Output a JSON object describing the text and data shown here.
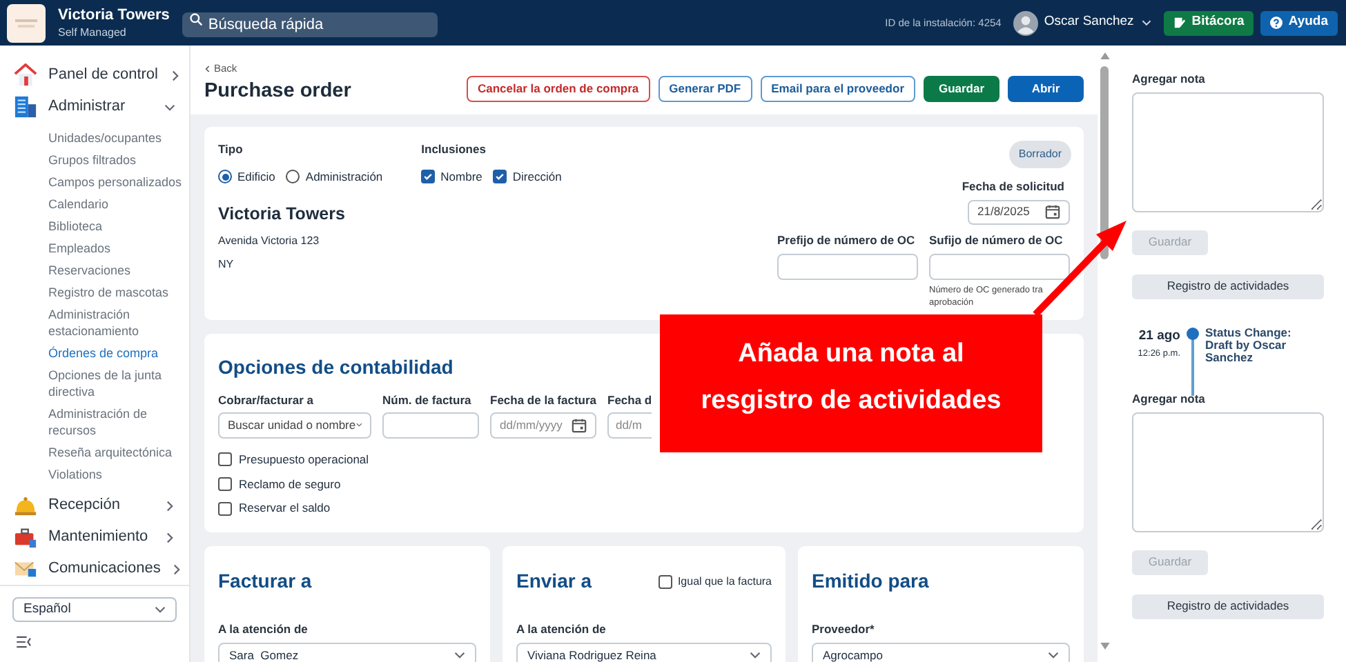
{
  "header": {
    "org_name": "Victoria Towers",
    "org_subtitle": "Self Managed",
    "search": {
      "placeholder": "Búsqueda rápida"
    },
    "installation_id": "ID de la instalación: 4254",
    "user_name": "Oscar Sanchez",
    "buttons": [
      {
        "label": "Bitácora",
        "kind": "log"
      },
      {
        "label": "Ayuda",
        "kind": "help"
      }
    ]
  },
  "sidebar": {
    "items": [
      {
        "label": "Panel de control",
        "expanded": false
      },
      {
        "label": "Administrar",
        "expanded": true,
        "children": [
          {
            "label": "Unidades/ocupantes",
            "selected": false
          },
          {
            "label": "Grupos filtrados",
            "selected": false
          },
          {
            "label": "Campos personalizados",
            "selected": false
          },
          {
            "label": "Calendario",
            "selected": false
          },
          {
            "label": "Biblioteca",
            "selected": false
          },
          {
            "label": "Empleados",
            "selected": false
          },
          {
            "label": "Reservaciones",
            "selected": false
          },
          {
            "label": "Registro de mascotas",
            "selected": false
          },
          {
            "label": "Administración estacionamiento",
            "selected": false
          },
          {
            "label": "Órdenes de compra",
            "selected": true
          },
          {
            "label": "Opciones de la junta directiva",
            "selected": false
          },
          {
            "label": "Administración de recursos",
            "selected": false
          },
          {
            "label": "Reseña arquitectónica",
            "selected": false
          },
          {
            "label": "Violations",
            "selected": false
          }
        ]
      },
      {
        "label": "Recepción",
        "expanded": false
      },
      {
        "label": "Mantenimiento",
        "expanded": false
      },
      {
        "label": "Comunicaciones",
        "expanded": false
      }
    ],
    "language": "Español"
  },
  "page": {
    "back": "Back",
    "title": "Purchase order",
    "actions": [
      {
        "label": "Cancelar la orden de compra",
        "kind": "danger"
      },
      {
        "label": "Generar PDF",
        "kind": "outline"
      },
      {
        "label": "Email para el proveedor",
        "kind": "outline"
      },
      {
        "label": "Guardar",
        "kind": "success"
      },
      {
        "label": "Abrir",
        "kind": "primary"
      }
    ]
  },
  "header_card": {
    "tipo_label": "Tipo",
    "tipo_options": [
      {
        "label": "Edificio",
        "selected": true
      },
      {
        "label": "Administración",
        "selected": false
      }
    ],
    "inclusions_label": "Inclusiones",
    "inclusions": [
      {
        "label": "Nombre",
        "checked": true
      },
      {
        "label": "Dirección",
        "checked": true
      }
    ],
    "status": "Borrador",
    "building_name": "Victoria Towers",
    "address_lines": [
      "Avenida Victoria 123",
      "NY"
    ],
    "request_date_label": "Fecha de solicitud",
    "request_date": "21/8/2025",
    "prefix_label": "Prefijo de número de OC",
    "suffix_label": "Sufijo de número de OC",
    "suffix_hint_lines": [
      "Número de OC generado tra",
      "aprobación"
    ]
  },
  "accounting": {
    "title": "Opciones de contabilidad",
    "fields": [
      {
        "label": "Cobrar/facturar a",
        "kind": "select",
        "placeholder": "Buscar unidad o nombre"
      },
      {
        "label": "Núm. de factura",
        "kind": "text"
      },
      {
        "label": "Fecha de la factura",
        "kind": "date",
        "placeholder": "dd/mm/yyyy"
      },
      {
        "label": "Fecha d",
        "kind": "cut",
        "placeholder": "dd/m"
      }
    ],
    "checkboxes": [
      {
        "label": "Presupuesto operacional",
        "checked": false
      },
      {
        "label": "Reclamo de seguro",
        "checked": false
      },
      {
        "label": "Reservar el saldo",
        "checked": false
      }
    ]
  },
  "parties": [
    {
      "title": "Facturar a",
      "field_label": "A la atención de",
      "value": "Sara  Gomez"
    },
    {
      "title": "Enviar a",
      "same_as": {
        "label": "Igual que la factura",
        "checked": false
      },
      "field_label": "A la atención de",
      "value": "Viviana Rodriguez Reina"
    },
    {
      "title": "Emitido para",
      "field_label": "Proveedor*",
      "value": "Agrocampo"
    }
  ],
  "notes_panel": {
    "sections": [
      {
        "note_label": "Agregar nota",
        "save": {
          "label": "Guardar",
          "disabled": true
        },
        "log_button": "Registro de actividades",
        "activities": [
          {
            "date": "21 ago",
            "time": "12:26 p.m.",
            "text": "Status Change: Draft by Oscar Sanchez"
          }
        ]
      },
      {
        "note_label": "Agregar nota",
        "save": {
          "label": "Guardar",
          "disabled": true
        },
        "log_button": "Registro de actividades"
      }
    ]
  },
  "callout": {
    "text": "Añada una nota al resgistro de actividades"
  }
}
